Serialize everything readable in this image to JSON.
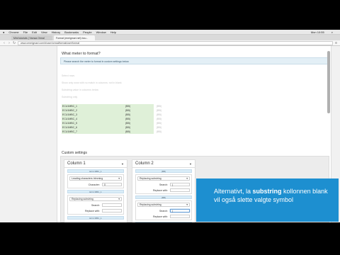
{
  "menubar": {
    "items": [
      "Chrome",
      "File",
      "Edit",
      "View",
      "History",
      "Bookmarks",
      "People",
      "Window",
      "Help"
    ],
    "clock": "Mon 10:55"
  },
  "tabs": [
    {
      "label": "Mini tutorials | Yamaa Ormal",
      "active": false
    },
    {
      "label": "Format (eneigmari.net) bou...",
      "active": true
    }
  ],
  "address": {
    "url": "www.ceneigmari.com/#/user/ormal/format/user/format"
  },
  "page": {
    "heading": "What meter to format?",
    "notice": "Please search the meter to format in custom settings below",
    "ghost_lines": [
      "Select rows",
      "Show only rows with no match in columns: not in blank",
      "Substring value in columns below",
      "Substring only"
    ],
    "rows": [
      {
        "c1": "ECU1MBC_1",
        "c2": "(BB)",
        "c3": "(BB)"
      },
      {
        "c1": "ECU1MBC_2",
        "c2": "(BB)",
        "c3": "(BB)"
      },
      {
        "c1": "ECU1MBC_3",
        "c2": "(BB)",
        "c3": "(BB)"
      },
      {
        "c1": "ECU1MBC_4",
        "c2": "(BB)",
        "c3": "(BB)"
      },
      {
        "c1": "ECU1MBC_5",
        "c2": "(BB)",
        "c3": "(BB)"
      },
      {
        "c1": "ECU1MBC_6",
        "c2": "(BB)",
        "c3": "(BB)"
      },
      {
        "c1": "ECU1MBC_7",
        "c2": "(BB)",
        "c3": "(BB)"
      }
    ],
    "custom_settings": "Custom settings",
    "col1": {
      "title": "Column 1",
      "chip1": "ECU MBC_1",
      "select1": "Leading characters trimming",
      "char_label": "Character:",
      "char_value": "0",
      "chip2": "ECU MBC_1",
      "select2": "Replacing substring",
      "search_label": "Search:",
      "replace_label": "Replace with:",
      "chip3": "ECU MBC_1"
    },
    "col2": {
      "title": "Column 2",
      "chip1": "(BB)",
      "select1": "Replacing substring",
      "search_label": "Search:",
      "search_value": "(",
      "replace_label": "Replace with:",
      "chip2": "(BB)",
      "select2": "Replacing substring",
      "search2_label": "Search:",
      "search2_value": ")",
      "replace2_label": "Replace with:",
      "chip3": "BB"
    }
  },
  "overlay": {
    "before": "Alternativt, la ",
    "bold": "substring",
    "after": " kollonnen blank vil også slette valgte symbol"
  }
}
